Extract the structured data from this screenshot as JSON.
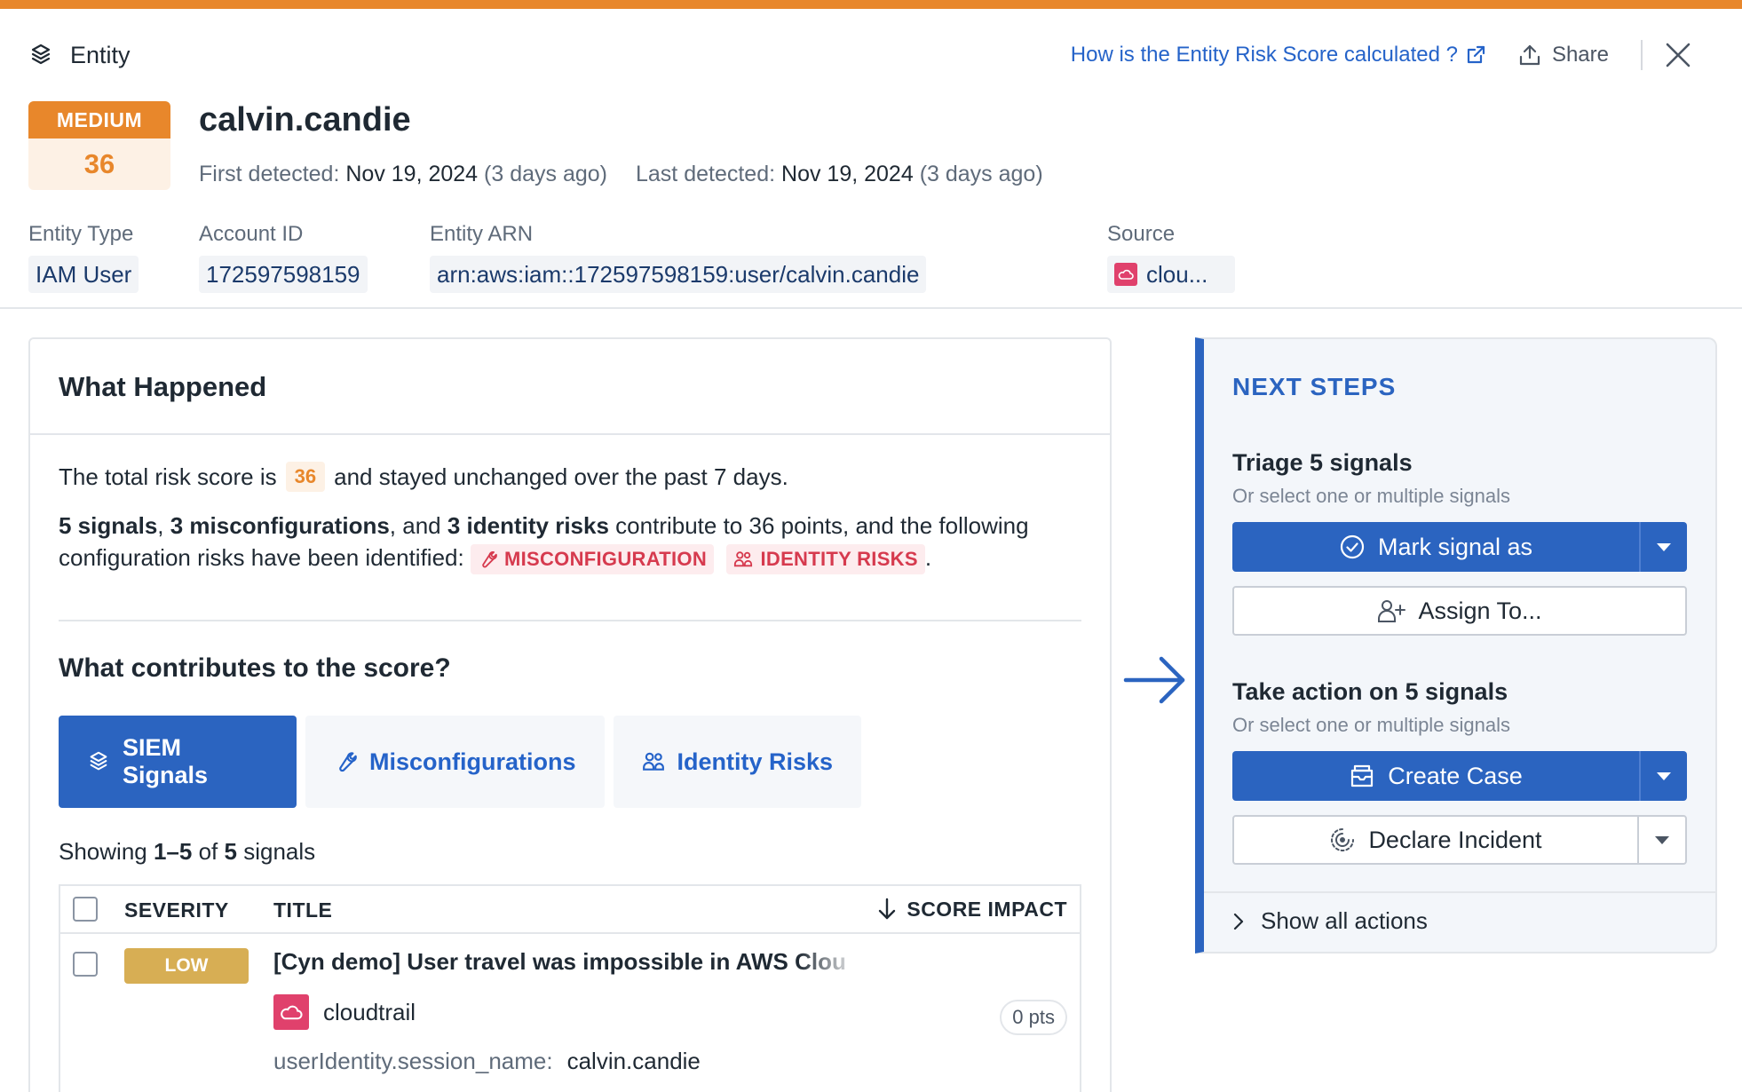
{
  "header": {
    "title": "Entity",
    "risk_score_link": "How is the Entity Risk Score calculated ?",
    "share_label": "Share"
  },
  "entity": {
    "severity": "MEDIUM",
    "score": "36",
    "name": "calvin.candie",
    "first_detected_label": "First detected:",
    "first_detected_date": "Nov 19, 2024",
    "first_detected_ago": "(3 days ago)",
    "last_detected_label": "Last detected:",
    "last_detected_date": "Nov 19, 2024",
    "last_detected_ago": "(3 days ago)",
    "type_label": "Entity Type",
    "type_value": "IAM User",
    "account_label": "Account ID",
    "account_value": "172597598159",
    "arn_label": "Entity ARN",
    "arn_value": "arn:aws:iam::172597598159:user/calvin.candie",
    "source_label": "Source",
    "source_value": "clou..."
  },
  "what_happened": {
    "title": "What Happened",
    "total_prefix": "The total risk score is",
    "total_score": "36",
    "total_suffix": "and stayed unchanged over the past 7 days.",
    "signals_count": "5 signals",
    "sep1": ",",
    "misconfig_count": "3 misconfigurations",
    "sep2": ", and",
    "identity_count": "3 identity risks",
    "contrib_text": "contribute to 36 points, and the following configuration risks have been identified:",
    "tag_misconfig": "MISCONFIGURATION",
    "tag_identity": "IDENTITY RISKS",
    "end_period": ".",
    "contributes_title": "What contributes to the score?",
    "tabs": [
      {
        "label": "SIEM Signals"
      },
      {
        "label": "Misconfigurations"
      },
      {
        "label": "Identity Risks"
      }
    ],
    "showing_prefix": "Showing",
    "showing_range": "1–5",
    "showing_of": "of",
    "showing_total": "5",
    "showing_suffix": "signals",
    "table": {
      "col_severity": "SEVERITY",
      "col_title": "TITLE",
      "col_score": "SCORE IMPACT",
      "rows": [
        {
          "severity": "LOW",
          "title": "[Cyn demo] User travel was impossible in AWS Clou",
          "source": "cloudtrail",
          "points": "0 pts",
          "attr_key": "userIdentity.session_name:",
          "attr_value": "calvin.candie"
        }
      ]
    }
  },
  "next_steps": {
    "title": "NEXT STEPS",
    "triage_title": "Triage 5 signals",
    "triage_sub": "Or select one or multiple signals",
    "mark_signal": "Mark signal as",
    "assign_to": "Assign To...",
    "action_title": "Take action on 5 signals",
    "action_sub": "Or select one or multiple signals",
    "create_case": "Create Case",
    "declare_incident": "Declare Incident",
    "show_all": "Show all actions"
  },
  "colors": {
    "accent_orange": "#e8872b",
    "primary_blue": "#2b64c0",
    "link_blue": "#2563c9",
    "risk_red": "#d63a4e",
    "low_yellow": "#d7ae54",
    "cloudtrail_pink": "#e0416c"
  }
}
